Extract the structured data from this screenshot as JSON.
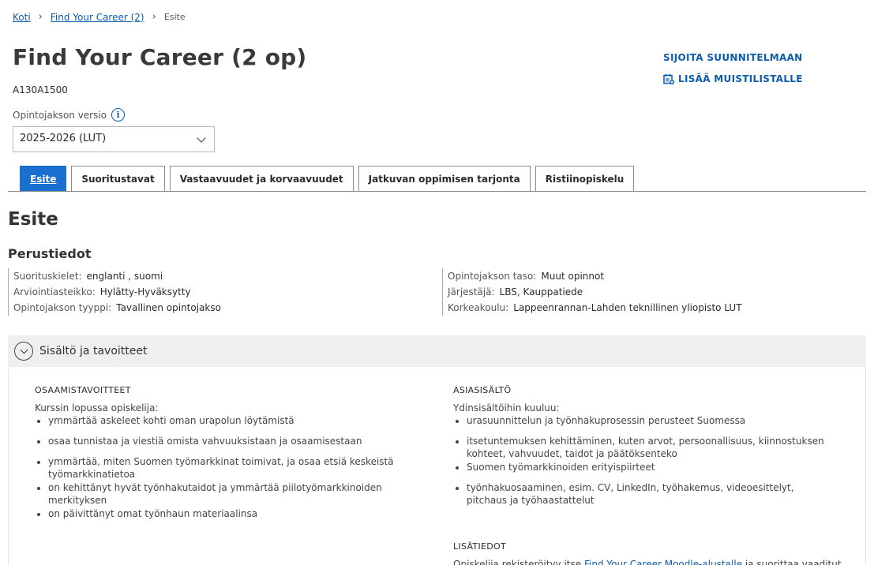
{
  "breadcrumb": {
    "home": "Koti",
    "parent": "Find Your Career (2)",
    "current": "Esite"
  },
  "course": {
    "title": "Find Your Career (2 op)",
    "code": "A130A1500",
    "version_label": "Opintojakson versio",
    "version_value": "2025-2026 (LUT)"
  },
  "actions": {
    "plan": "SIJOITA SUUNNITELMAAN",
    "memo": "LISÄÄ MUISTILISTALLE"
  },
  "tabs": [
    {
      "label": "Esite"
    },
    {
      "label": "Suoritustavat"
    },
    {
      "label": "Vastaavuudet ja korvaavuudet"
    },
    {
      "label": "Jatkuvan oppimisen tarjonta"
    },
    {
      "label": "Ristiinopiskelu"
    }
  ],
  "section": {
    "title": "Esite",
    "basics_title": "Perustiedot"
  },
  "info_left": [
    {
      "label": "Suorituskielet:",
      "value": "englanti ,  suomi"
    },
    {
      "label": "Arviointiasteikko:",
      "value": "Hylätty-Hyväksytty"
    },
    {
      "label": "Opintojakson tyyppi:",
      "value": "Tavallinen opintojakso"
    }
  ],
  "info_right": [
    {
      "label": "Opintojakson taso:",
      "value": "Muut opinnot"
    },
    {
      "label": "Järjestäjä:",
      "value": "LBS, Kauppatiede"
    },
    {
      "label": "Korkeakoulu:",
      "value": "Lappeenrannan-Lahden teknillinen yliopisto LUT"
    }
  ],
  "accordion": {
    "title": "Sisältö ja tavoitteet",
    "goals": {
      "heading": "OSAAMISTAVOITTEET",
      "intro": "Kurssin lopussa opiskelija:",
      "items": [
        "ymmärtää askeleet kohti oman urapolun löytämistä",
        "osaa tunnistaa ja viestiä omista vahvuuksistaan ja osaamisestaan",
        "ymmärtää, miten Suomen työmarkkinat toimivat, ja osaa etsiä keskeistä työmarkkinatietoa",
        "on kehittänyt hyvät työnhakutaidot ja ymmärtää piilotyömarkkinoiden merkityksen",
        "on päivittänyt omat työnhaun materiaalinsa"
      ]
    },
    "content": {
      "heading": "ASIASISÄLTÖ",
      "intro": "Ydinsisältöihin kuuluu:",
      "items": [
        "urasuunnittelun ja työnhakuprosessin perusteet Suomessa",
        "itsetuntemuksen kehittäminen, kuten arvot, persoonallisuus, kiinnostuksen kohteet, vahvuudet, taidot ja päätöksenteko",
        "Suomen työmarkkinoiden erityispiirteet",
        "työnhakuosaaminen, esim. CV, LinkedIn, työhakemus, videoesittelyt, pitchaus ja työhaastattelut"
      ]
    },
    "extra": {
      "heading": "LISÄTIEDOT",
      "text_start": "Opiskelija rekisteröityy itse ",
      "link": "Find Your Career Moodle-alustalle",
      "text_end": " ja suorittaa vaaditut"
    }
  }
}
